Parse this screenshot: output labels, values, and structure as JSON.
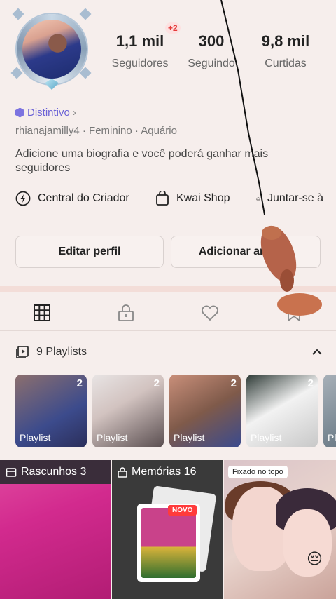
{
  "profile": {
    "followers_count": "1,1 mil",
    "followers_label": "Seguidores",
    "followers_badge": "+2",
    "following_count": "300",
    "following_label": "Seguindo",
    "likes_count": "9,8 mil",
    "likes_label": "Curtidas",
    "badge_label": "Distintivo",
    "meta": "rhianajamilly4 · Feminino · Aquário",
    "bio": "Adicione uma biografia e você poderá ganhar mais seguidores"
  },
  "quicklinks": [
    {
      "label": "Central do Criador",
      "icon": "creator-bolt-icon"
    },
    {
      "label": "Kwai Shop",
      "icon": "shopping-bag-icon"
    },
    {
      "label": "Juntar-se à",
      "icon": "community-icon"
    }
  ],
  "buttons": {
    "edit_profile": "Editar perfil",
    "add_friends": "Adicionar amigos"
  },
  "tabs": [
    {
      "name": "grid",
      "icon": "grid-icon",
      "active": true
    },
    {
      "name": "private",
      "icon": "lock-icon",
      "active": false
    },
    {
      "name": "liked",
      "icon": "heart-icon",
      "active": false
    },
    {
      "name": "bookmarks",
      "icon": "bookmark-icon",
      "active": false
    }
  ],
  "playlists": {
    "header": "9 Playlists",
    "items": [
      {
        "count": "2",
        "caption": "Playlist"
      },
      {
        "count": "2",
        "caption": "Playlist"
      },
      {
        "count": "2",
        "caption": "Playlist"
      },
      {
        "count": "2",
        "caption": "Playlist"
      },
      {
        "count": "",
        "caption": "Pla"
      }
    ]
  },
  "grid": {
    "drafts_label": "Rascunhos 3",
    "memories_label": "Memórias 16",
    "new_badge": "NOVO",
    "pinned_label": "Fixado no topo",
    "emoji": "😔"
  },
  "colors": {
    "background": "#f6eeec",
    "accent_purple": "#6c63d6",
    "badge_red": "#e53a3a"
  }
}
